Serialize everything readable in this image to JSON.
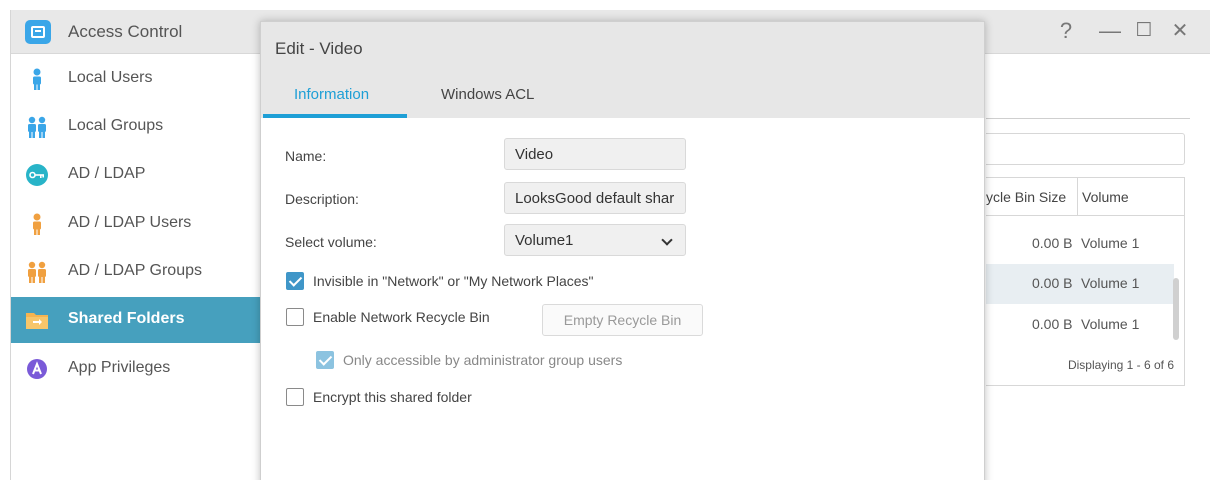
{
  "window": {
    "title": "Access Control",
    "controls": {
      "help": "?",
      "minimize": "—",
      "maximize": "☐",
      "close": "✕"
    }
  },
  "sidebar": {
    "items": [
      {
        "label": "Local Users",
        "icon": "user-icon",
        "color": "#3aa6e8"
      },
      {
        "label": "Local Groups",
        "icon": "group-icon",
        "color": "#3aa6e8"
      },
      {
        "label": "AD / LDAP",
        "icon": "key-icon",
        "color": "#28b4c8"
      },
      {
        "label": "AD / LDAP Users",
        "icon": "user-icon",
        "color": "#f0a040"
      },
      {
        "label": "AD / LDAP Groups",
        "icon": "group-icon",
        "color": "#f0a040"
      },
      {
        "label": "Shared Folders",
        "icon": "folder-icon",
        "color": "#f0a040",
        "active": true
      },
      {
        "label": "App Privileges",
        "icon": "app-icon",
        "color": "#7a5ad8"
      }
    ]
  },
  "background_table": {
    "headers": [
      "ycle Bin Size",
      "Volume"
    ],
    "rows": [
      {
        "size": "0.00 B",
        "volume": "Volume 1"
      },
      {
        "size": "0.00 B",
        "volume": "Volume 1",
        "selected": true
      },
      {
        "size": "0.00 B",
        "volume": "Volume 1"
      }
    ],
    "footer": "Displaying 1 - 6 of 6"
  },
  "dialog": {
    "title": "Edit - Video",
    "tabs": [
      "Information",
      "Windows ACL"
    ],
    "active_tab": "Information",
    "fields": {
      "name_label": "Name:",
      "name_value": "Video",
      "description_label": "Description:",
      "description_value": "LooksGood default shar",
      "volume_label": "Select volume:",
      "volume_value": "Volume1"
    },
    "options": {
      "invisible": {
        "label": "Invisible in \"Network\" or \"My Network Places\"",
        "checked": true
      },
      "recycle_bin": {
        "label": "Enable Network Recycle Bin",
        "checked": false
      },
      "empty_recycle_bin": "Empty Recycle Bin",
      "admin_only": {
        "label": "Only accessible by administrator group users",
        "checked": true,
        "disabled": true
      },
      "encrypt": {
        "label": "Encrypt this shared folder",
        "checked": false
      }
    }
  },
  "colors": {
    "accent": "#1e9fd6",
    "sidebar_active": "#46a0be",
    "checkbox": "#3f96c8"
  }
}
